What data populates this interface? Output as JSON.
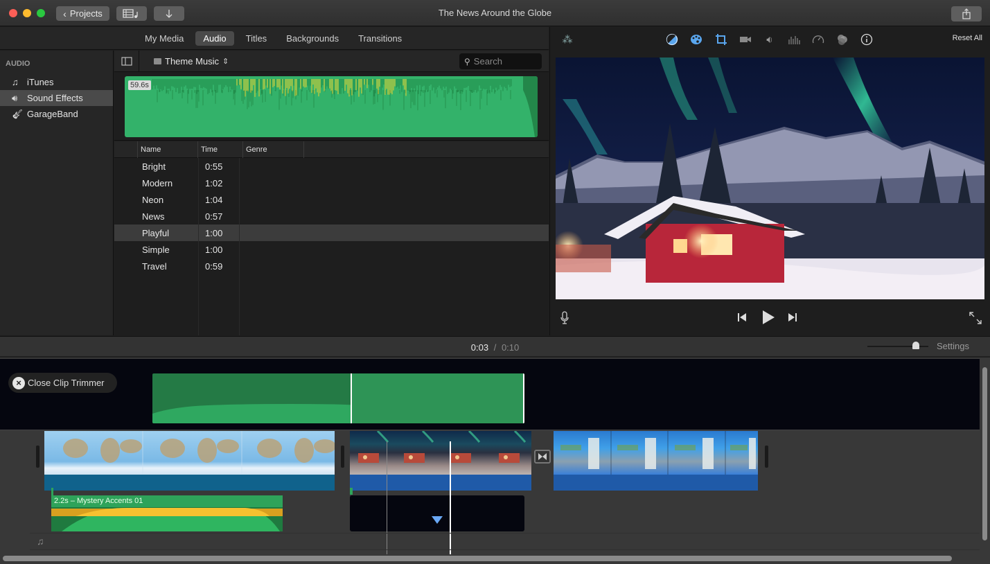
{
  "window": {
    "title": "The News Around the Globe",
    "projects_button": "Projects",
    "media_button_icon": "film-music-icon",
    "import_button_icon": "download-arrow-icon",
    "share_button_icon": "share-icon"
  },
  "browser_tabs": [
    {
      "label": "My Media",
      "active": false
    },
    {
      "label": "Audio",
      "active": true
    },
    {
      "label": "Titles",
      "active": false
    },
    {
      "label": "Backgrounds",
      "active": false
    },
    {
      "label": "Transitions",
      "active": false
    }
  ],
  "sidebar": {
    "heading": "AUDIO",
    "items": [
      {
        "label": "iTunes",
        "icon": "music-note-icon",
        "selected": false
      },
      {
        "label": "Sound Effects",
        "icon": "speaker-icon",
        "selected": true
      },
      {
        "label": "GarageBand",
        "icon": "guitar-icon",
        "selected": false
      }
    ]
  },
  "library": {
    "folder": "Theme Music",
    "search_placeholder": "Search",
    "preview_duration": "59.6s",
    "columns": [
      "Name",
      "Time",
      "Genre"
    ],
    "rows": [
      {
        "name": "Bright",
        "time": "0:55",
        "genre": ""
      },
      {
        "name": "Modern",
        "time": "1:02",
        "genre": ""
      },
      {
        "name": "Neon",
        "time": "1:04",
        "genre": ""
      },
      {
        "name": "News",
        "time": "0:57",
        "genre": ""
      },
      {
        "name": "Playful",
        "time": "1:00",
        "genre": "",
        "selected": true
      },
      {
        "name": "Simple",
        "time": "1:00",
        "genre": ""
      },
      {
        "name": "Travel",
        "time": "0:59",
        "genre": ""
      }
    ]
  },
  "viewer": {
    "tools": [
      "magic-wand-icon",
      "color-balance-icon",
      "color-correction-icon",
      "crop-icon",
      "stabilization-icon",
      "volume-icon",
      "equalizer-icon",
      "speed-icon",
      "filter-icon",
      "info-icon"
    ],
    "reset_all": "Reset All",
    "preview_alt": "Red cabin under northern lights"
  },
  "timeline": {
    "current_time": "0:03",
    "separator": "/",
    "total_time": "0:10",
    "zoom_level": 0.8,
    "settings": "Settings",
    "close_trimmer": "Close Clip Trimmer",
    "audio_clip_label": "2.2s – Mystery Accents 01"
  },
  "colors": {
    "audio_green": "#33b26a",
    "video_band": "#1f5aa8",
    "map_band": "#10628c",
    "playhead_marker": "#6aa8f5"
  }
}
